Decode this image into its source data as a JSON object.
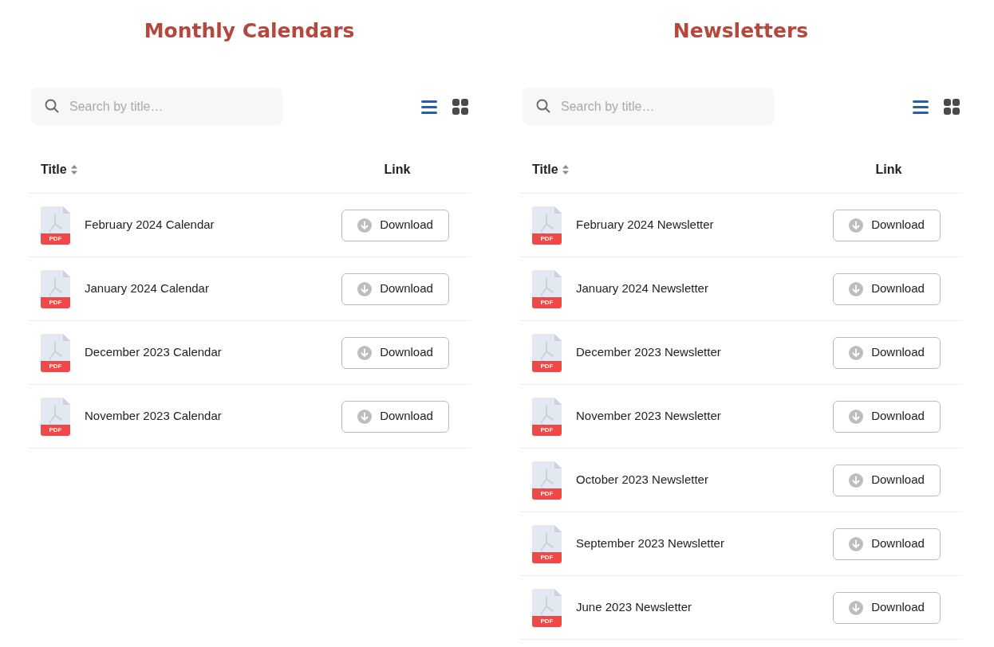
{
  "sections": [
    {
      "title": "Monthly Calendars",
      "search": {
        "placeholder": "Search by title…"
      },
      "view_modes": [
        {
          "kind": "list",
          "selected": true
        },
        {
          "kind": "grid",
          "selected": false
        }
      ],
      "table": {
        "columns": [
          {
            "label": "Title",
            "sortable": true
          },
          {
            "label": "Link",
            "sortable": false
          }
        ],
        "rows": [
          {
            "file_badge": "PDF",
            "title": "February 2024 Calendar",
            "action": "Download"
          },
          {
            "file_badge": "PDF",
            "title": "January 2024 Calendar",
            "action": "Download"
          },
          {
            "file_badge": "PDF",
            "title": "December 2023 Calendar",
            "action": "Download"
          },
          {
            "file_badge": "PDF",
            "title": "November 2023 Calendar",
            "action": "Download"
          }
        ]
      }
    },
    {
      "title": "Newsletters",
      "search": {
        "placeholder": "Search by title…"
      },
      "view_modes": [
        {
          "kind": "list",
          "selected": true
        },
        {
          "kind": "grid",
          "selected": false
        }
      ],
      "table": {
        "columns": [
          {
            "label": "Title",
            "sortable": true
          },
          {
            "label": "Link",
            "sortable": false
          }
        ],
        "rows": [
          {
            "file_badge": "PDF",
            "title": "February 2024 Newsletter",
            "action": "Download"
          },
          {
            "file_badge": "PDF",
            "title": "January 2024 Newsletter",
            "action": "Download"
          },
          {
            "file_badge": "PDF",
            "title": "December 2023 Newsletter",
            "action": "Download"
          },
          {
            "file_badge": "PDF",
            "title": "November 2023 Newsletter",
            "action": "Download"
          },
          {
            "file_badge": "PDF",
            "title": "October 2023 Newsletter",
            "action": "Download"
          },
          {
            "file_badge": "PDF",
            "title": "September 2023 Newsletter",
            "action": "Download"
          },
          {
            "file_badge": "PDF",
            "title": "June 2023 Newsletter",
            "action": "Download"
          }
        ]
      }
    }
  ]
}
